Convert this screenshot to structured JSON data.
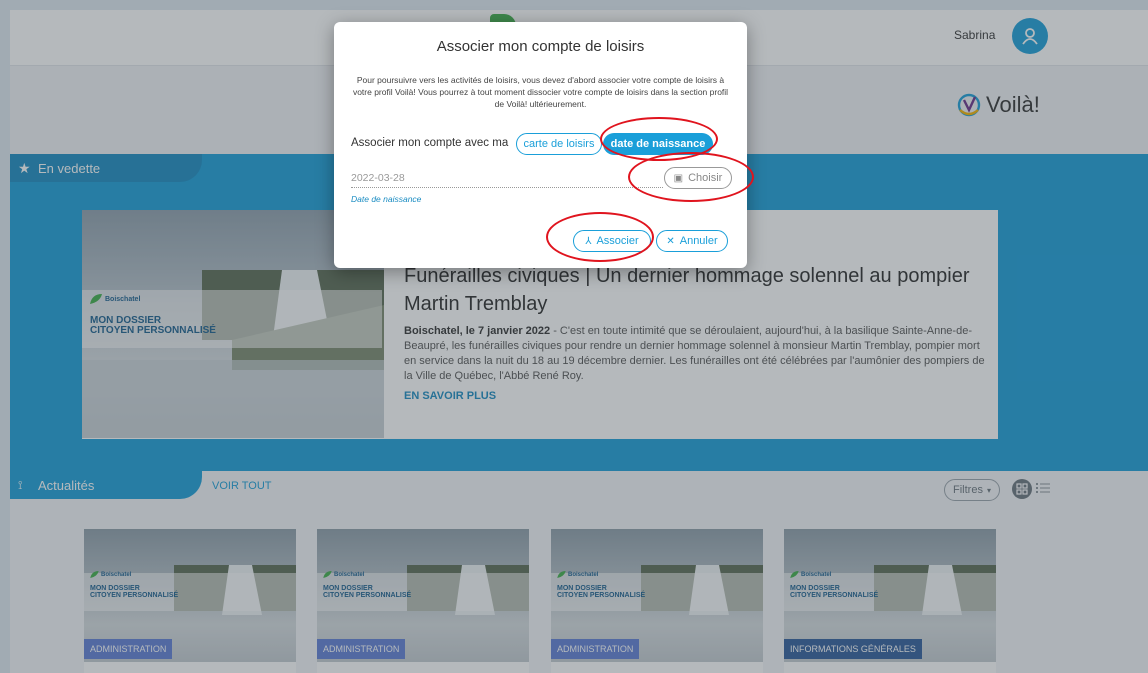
{
  "header": {
    "user_name": "Sabrina",
    "brand_name": "Voilà!"
  },
  "featured": {
    "section_label": "En vedette",
    "article": {
      "image_org": "Boischatel",
      "image_caption_line1": "MON DOSSIER",
      "image_caption_line2": "CITOYEN PERSONNALISÉ",
      "title": "Funérailles civiques | Un dernier hommage solennel au pompier Martin Tremblay",
      "body_lead": "Boischatel, le 7 janvier 2022",
      "body_text": " - C'est en toute intimité que se déroulaient, aujourd'hui, à la basilique Sainte-Anne-de-Beaupré, les funérailles civiques pour rendre un dernier hommage solennel à monsieur Martin Tremblay, pompier mort en service dans la nuit du 18 au 19 décembre dernier. Les funérailles ont été célébrées par l'aumônier des pompiers de la Ville de Québec, l'Abbé René Roy.",
      "read_more": "EN SAVOIR PLUS"
    }
  },
  "news": {
    "section_label": "Actualités",
    "see_all": "VOIR TOUT",
    "filters_label": "Filtres",
    "cards": [
      {
        "org": "Boischatel",
        "line1": "MON DOSSIER",
        "line2": "CITOYEN PERSONNALISÉ",
        "category": "ADMINISTRATION"
      },
      {
        "org": "Boischatel",
        "line1": "MON DOSSIER",
        "line2": "CITOYEN PERSONNALISÉ",
        "category": "ADMINISTRATION"
      },
      {
        "org": "Boischatel",
        "line1": "MON DOSSIER",
        "line2": "CITOYEN PERSONNALISÉ",
        "category": "ADMINISTRATION"
      },
      {
        "org": "Boischatel",
        "line1": "MON DOSSIER",
        "line2": "CITOYEN PERSONNALISÉ",
        "category": "INFORMATIONS GÉNÉRALES"
      }
    ]
  },
  "modal": {
    "title": "Associer mon compte de loisirs",
    "description": "Pour poursuivre vers les activités de loisirs, vous devez d'abord associer votre compte de loisirs à votre profil Voilà! Vous pourrez à tout moment dissocier votre compte de loisirs dans la section profil de Voilà! ultérieurement.",
    "associate_with_label": "Associer mon compte avec ma",
    "option_card": "carte de loisirs",
    "option_birthdate": "date de naissance",
    "date_value": "2022-03-28",
    "choose_button": "Choisir",
    "date_hint": "Date de naissance",
    "associate_button": "Associer",
    "cancel_button": "Annuler"
  },
  "colors": {
    "accent": "#1a9fd9",
    "accent_dark": "#1a8cc2",
    "highlight_ring": "#e0141e",
    "badge": "#5f7fd6"
  }
}
